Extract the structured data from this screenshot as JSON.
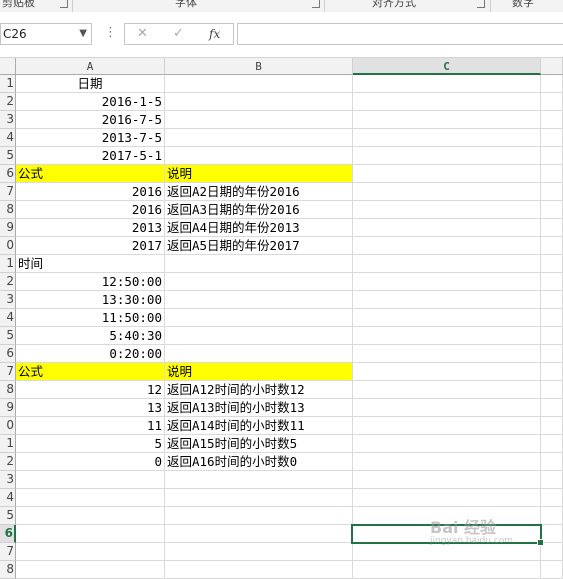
{
  "ribbon": {
    "groups": [
      "剪贴板",
      "字体",
      "对齐方式",
      "数字"
    ]
  },
  "formula_bar": {
    "name_box": "C26",
    "cancel_icon": "✕",
    "enter_icon": "✓",
    "fx_label": "fx",
    "formula": ""
  },
  "columns": [
    "A",
    "B",
    "C"
  ],
  "selected_column": "C",
  "rows": [
    {
      "n": "1",
      "a": "日期",
      "b": "",
      "a_align": "c"
    },
    {
      "n": "2",
      "a": "2016-1-5",
      "b": "",
      "a_align": "r"
    },
    {
      "n": "3",
      "a": "2016-7-5",
      "b": "",
      "a_align": "r"
    },
    {
      "n": "4",
      "a": "2013-7-5",
      "b": "",
      "a_align": "r"
    },
    {
      "n": "5",
      "a": "2017-5-1",
      "b": "",
      "a_align": "r"
    },
    {
      "n": "6",
      "a": "公式",
      "b": "说明",
      "a_align": "l",
      "highlight": true
    },
    {
      "n": "7",
      "a": "2016",
      "b": "返回A2日期的年份2016",
      "a_align": "r"
    },
    {
      "n": "8",
      "a": "2016",
      "b": "返回A3日期的年份2016",
      "a_align": "r"
    },
    {
      "n": "9",
      "a": "2013",
      "b": "返回A4日期的年份2013",
      "a_align": "r"
    },
    {
      "n": "0",
      "a": "2017",
      "b": "返回A5日期的年份2017",
      "a_align": "r"
    },
    {
      "n": "1",
      "a": "时间",
      "b": "",
      "a_align": "l"
    },
    {
      "n": "2",
      "a": "12:50:00",
      "b": "",
      "a_align": "r"
    },
    {
      "n": "3",
      "a": "13:30:00",
      "b": "",
      "a_align": "r"
    },
    {
      "n": "4",
      "a": "11:50:00",
      "b": "",
      "a_align": "r"
    },
    {
      "n": "5",
      "a": "5:40:30",
      "b": "",
      "a_align": "r"
    },
    {
      "n": "6",
      "a": "0:20:00",
      "b": "",
      "a_align": "r"
    },
    {
      "n": "7",
      "a": "公式",
      "b": "说明",
      "a_align": "l",
      "highlight": true
    },
    {
      "n": "8",
      "a": "12",
      "b": "返回A12时间的小时数12",
      "a_align": "r"
    },
    {
      "n": "9",
      "a": "13",
      "b": "返回A13时间的小时数13",
      "a_align": "r"
    },
    {
      "n": "0",
      "a": "11",
      "b": "返回A14时间的小时数11",
      "a_align": "r"
    },
    {
      "n": "1",
      "a": "5",
      "b": "返回A15时间的小时数5",
      "a_align": "r"
    },
    {
      "n": "2",
      "a": "0",
      "b": "返回A16时间的小时数0",
      "a_align": "r"
    },
    {
      "n": "3",
      "a": "",
      "b": "",
      "a_align": "l"
    },
    {
      "n": "4",
      "a": "",
      "b": "",
      "a_align": "l"
    },
    {
      "n": "5",
      "a": "",
      "b": "",
      "a_align": "l"
    },
    {
      "n": "6",
      "a": "",
      "b": "",
      "a_align": "l",
      "active": true
    },
    {
      "n": "7",
      "a": "",
      "b": "",
      "a_align": "l"
    },
    {
      "n": "8",
      "a": "",
      "b": "",
      "a_align": "l"
    }
  ],
  "colors": {
    "highlight": "#ffff00",
    "selection": "#217346"
  },
  "watermark": {
    "brand": "Bai 经验",
    "url": "jingyan.baidu.com"
  }
}
